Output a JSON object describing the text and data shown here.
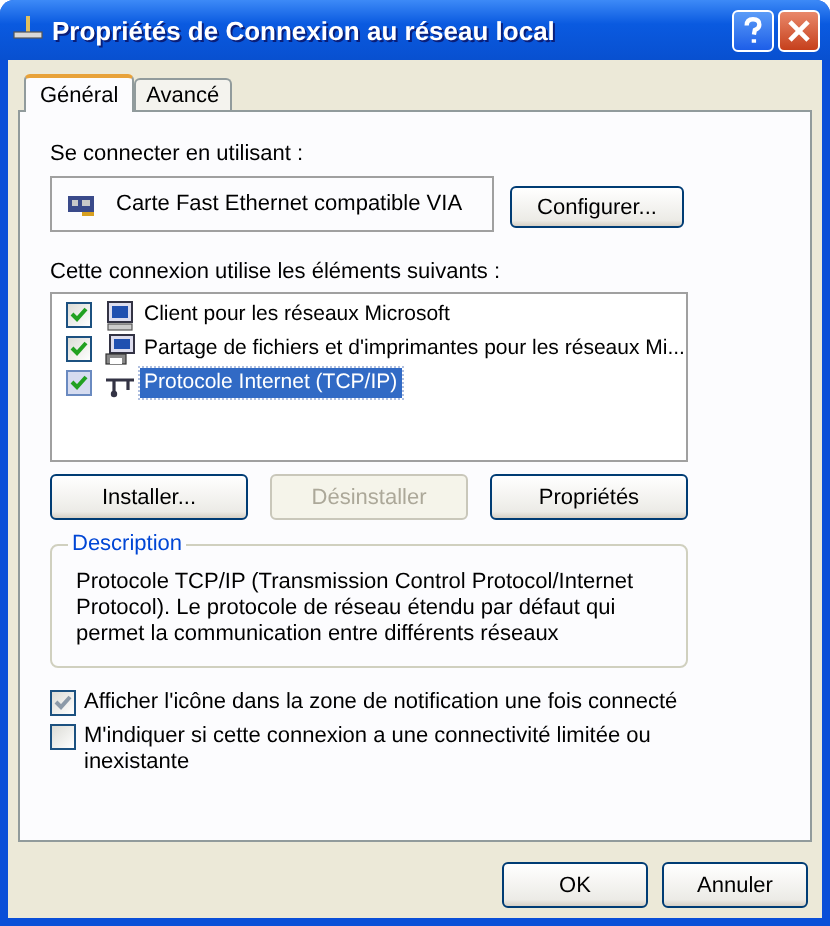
{
  "window": {
    "title": "Propriétés de Connexion au réseau local"
  },
  "tabs": [
    {
      "label": "Général",
      "selected": true
    },
    {
      "label": "Avancé",
      "selected": false
    }
  ],
  "connect_using": {
    "label": "Se connecter en utilisant :",
    "adapter": "Carte Fast Ethernet compatible VIA",
    "button": "Configurer..."
  },
  "components": {
    "label": "Cette connexion utilise les éléments suivants :",
    "items": [
      {
        "kind": "client",
        "name": "Client pour les réseaux Microsoft",
        "checked": true,
        "selected": false
      },
      {
        "kind": "share",
        "name": "Partage de fichiers et d'imprimantes pour les réseaux Mi...",
        "checked": true,
        "selected": false
      },
      {
        "kind": "protocol",
        "name": "Protocole Internet (TCP/IP)",
        "checked": true,
        "selected": true
      }
    ]
  },
  "component_buttons": [
    {
      "label": "Installer...",
      "disabled": false
    },
    {
      "label": "Désinstaller",
      "disabled": true
    },
    {
      "label": "Propriétés",
      "disabled": false
    }
  ],
  "description": {
    "title": "Description",
    "text": "Protocole TCP/IP (Transmission Control Protocol/Internet Protocol). Le protocole de réseau étendu par défaut qui permet la communication entre différents réseaux"
  },
  "options": [
    {
      "label": "Afficher l'icône dans la zone de notification une fois connecté",
      "checked": true
    },
    {
      "label": "M'indiquer si cette connexion a une connectivité limitée ou inexistante",
      "checked": false
    }
  ],
  "buttons": [
    "OK",
    "Annuler"
  ]
}
